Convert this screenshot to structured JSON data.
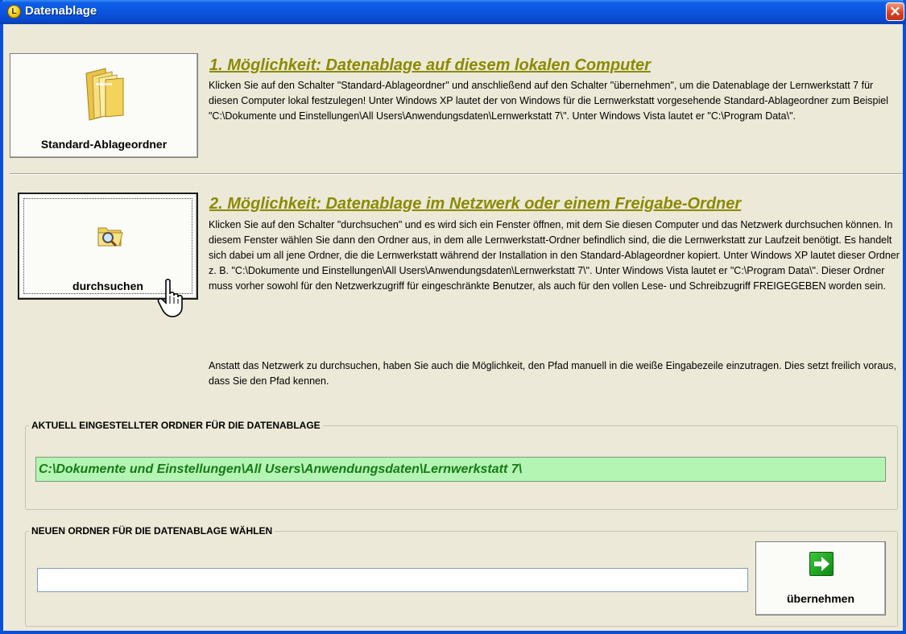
{
  "window": {
    "title": "Datenablage",
    "close_symbol": "✕"
  },
  "option1": {
    "button_label": "Standard-Ablageordner",
    "heading": "1. Möglichkeit: Datenablage auf diesem lokalen Computer",
    "text": "Klicken Sie auf den Schalter \"Standard-Ablageordner\" und anschließend auf den Schalter \"übernehmen\", um die Datenablage der Lernwerkstatt 7 für diesen Computer lokal festzulegen! Unter Windows XP lautet der von Windows für die Lernwerkstatt vorgesehende Standard-Ablageordner zum Beispiel \"C:\\Dokumente und Einstellungen\\All Users\\Anwendungsdaten\\Lernwerkstatt 7\\\". Unter Windows Vista lautet er \"C:\\Program Data\\\"."
  },
  "option2": {
    "button_label": "durchsuchen",
    "heading": "2. Möglichkeit: Datenablage im Netzwerk oder einem Freigabe-Ordner",
    "text": "Klicken Sie auf den Schalter \"durchsuchen\" und es wird sich ein Fenster öffnen, mit dem Sie diesen Computer und das Netzwerk durchsuchen können. In diesem Fenster wählen Sie dann den Ordner aus, in dem alle Lernwerkstatt-Ordner befindlich sind, die die Lernwerkstatt zur Laufzeit benötigt. Es handelt sich dabei um all jene Ordner, die die Lernwerkstatt während der Installation in den Standard-Ablageordner kopiert. Unter Windows XP lautet dieser Ordner z. B. \"C:\\Dokumente und Einstellungen\\All Users\\Anwendungsdaten\\Lernwerkstatt 7\\\". Unter Windows Vista lautet er \"C:\\Program Data\\\". Dieser Ordner muss vorher sowohl für den Netzwerkzugriff für eingeschränkte Benutzer, als auch für den vollen Lese- und Schreibzugriff FREIGEGEBEN worden sein.",
    "text2": "Anstatt das Netzwerk zu durchsuchen, haben Sie auch die Möglichkeit, den Pfad manuell in die weiße Eingabezeile einzutragen. Dies setzt freilich voraus, dass Sie den Pfad kennen."
  },
  "current": {
    "legend": "AKTUELL EINGESTELLTER ORDNER FÜR DIE DATENABLAGE",
    "path": "C:\\Dokumente und Einstellungen\\All Users\\Anwendungsdaten\\Lernwerkstatt 7\\"
  },
  "new_folder": {
    "legend": "NEUEN ORDNER FÜR DIE DATENABLAGE WÄHLEN",
    "input_value": "",
    "button_label": "übernehmen"
  },
  "colors": {
    "heading": "#8a8a00",
    "path_bg": "#b4f5b4",
    "path_text": "#167a16",
    "titlebar": "#0a55e0"
  },
  "icons": [
    "app-clock-icon",
    "close-icon",
    "folder-icon",
    "folder-search-icon",
    "hand-cursor-icon",
    "arrow-right-icon"
  ]
}
